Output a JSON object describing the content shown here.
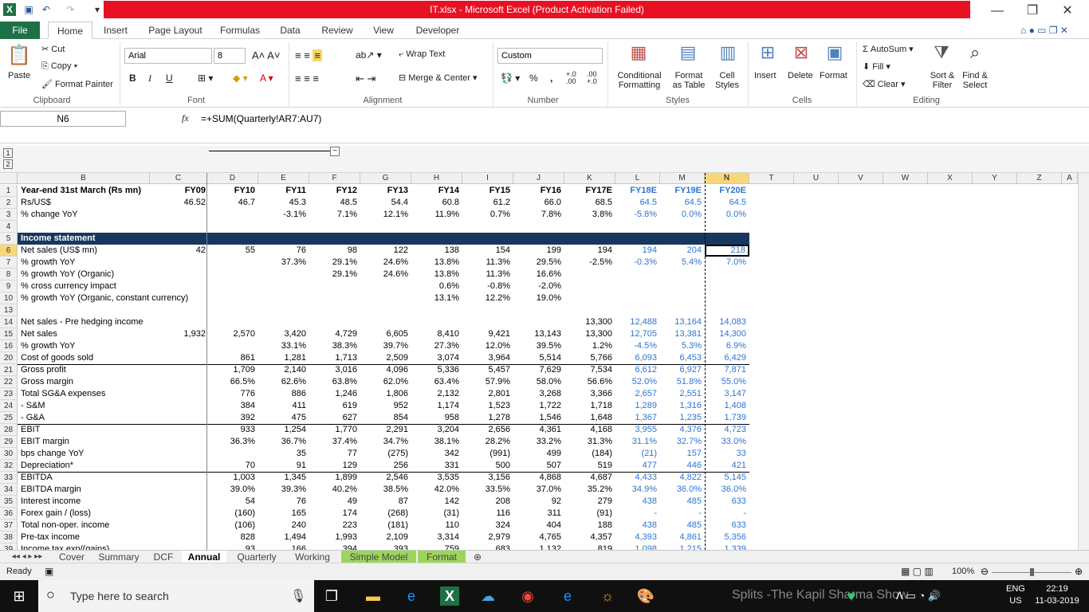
{
  "window": {
    "title": "IT.xlsx  -  Microsoft Excel (Product Activation Failed)"
  },
  "ribbon_tabs": [
    "File",
    "Home",
    "Insert",
    "Page Layout",
    "Formulas",
    "Data",
    "Review",
    "View",
    "Developer"
  ],
  "clipboard": {
    "paste": "Paste",
    "cut": "Cut",
    "copy": "Copy",
    "format_painter": "Format Painter",
    "label": "Clipboard"
  },
  "font": {
    "name": "Arial",
    "size": "8",
    "label": "Font",
    "bold": "B",
    "italic": "I",
    "underline": "U"
  },
  "alignment": {
    "wrap": "Wrap Text",
    "merge": "Merge & Center",
    "label": "Alignment"
  },
  "number": {
    "format": "Custom",
    "percent": "%",
    "comma": ",",
    "inc": "+.0 .00",
    "dec": ".00 +.0",
    "label": "Number"
  },
  "styles": {
    "cond": "Conditional",
    "cond2": "Formatting",
    "fmt_table": "Format",
    "fmt_table2": "as Table",
    "cell_styles": "Cell",
    "cell_styles2": "Styles",
    "label": "Styles"
  },
  "cells": {
    "insert": "Insert",
    "delete": "Delete",
    "format": "Format",
    "label": "Cells"
  },
  "editing": {
    "autosum": "AutoSum",
    "fill": "Fill",
    "clear": "Clear",
    "sort": "Sort &",
    "sort2": "Filter",
    "find": "Find &",
    "find2": "Select",
    "label": "Editing"
  },
  "formula_bar": {
    "name_box": "N6",
    "fx": "fx",
    "formula": "=+SUM(Quarterly!AR7:AU7)"
  },
  "outline_levels": [
    "1",
    "2"
  ],
  "columns": [
    "B",
    "C",
    "D",
    "E",
    "F",
    "G",
    "H",
    "I",
    "J",
    "K",
    "L",
    "M",
    "N",
    "T",
    "U",
    "V",
    "W",
    "X",
    "Y",
    "Z",
    "A"
  ],
  "selected_column": "N",
  "selected_row": "6",
  "rows": [
    {
      "n": "1",
      "label": "Year-end 31st March (Rs mn)",
      "c": "FY09",
      "vals": [
        "FY10",
        "FY11",
        "FY12",
        "FY13",
        "FY14",
        "FY15",
        "FY16",
        "FY17E",
        "FY18E",
        "FY19E",
        "FY20E"
      ],
      "bold": true,
      "header": true
    },
    {
      "n": "2",
      "label": "Rs/US$",
      "c": "46.52",
      "vals": [
        "46.7",
        "45.3",
        "48.5",
        "54.4",
        "60.8",
        "61.2",
        "66.0",
        "68.5",
        "64.5",
        "64.5",
        "64.5"
      ]
    },
    {
      "n": "3",
      "label": "% change YoY",
      "c": "",
      "vals": [
        "",
        "-3.1%",
        "7.1%",
        "12.1%",
        "11.9%",
        "0.7%",
        "7.8%",
        "3.8%",
        "-5.8%",
        "0.0%",
        "0.0%"
      ]
    },
    {
      "n": "4",
      "label": "",
      "c": "",
      "vals": [
        "",
        "",
        "",
        "",
        "",
        "",
        "",
        "",
        "",
        "",
        ""
      ]
    },
    {
      "n": "5",
      "label": "Income statement",
      "c": "",
      "vals": [
        "",
        "",
        "",
        "",
        "",
        "",
        "",
        "",
        "",
        "",
        ""
      ],
      "band": true
    },
    {
      "n": "6",
      "label": "Net sales (US$ mn)",
      "c": "42",
      "vals": [
        "55",
        "76",
        "98",
        "122",
        "138",
        "154",
        "199",
        "194",
        "194",
        "204",
        "218"
      ]
    },
    {
      "n": "7",
      "label": "% growth YoY",
      "c": "",
      "vals": [
        "",
        "37.3%",
        "29.1%",
        "24.6%",
        "13.8%",
        "11.3%",
        "29.5%",
        "-2.5%",
        "-0.3%",
        "5.4%",
        "7.0%"
      ]
    },
    {
      "n": "8",
      "label": "% growth YoY (Organic)",
      "c": "",
      "vals": [
        "",
        "",
        "29.1%",
        "24.6%",
        "13.8%",
        "11.3%",
        "16.6%",
        "",
        "",
        "",
        ""
      ]
    },
    {
      "n": "9",
      "label": "% cross currency impact",
      "c": "",
      "vals": [
        "",
        "",
        "",
        "",
        "0.6%",
        "-0.8%",
        "-2.0%",
        "",
        "",
        "",
        ""
      ]
    },
    {
      "n": "10",
      "label": "% growth YoY (Organic, constant currency)",
      "c": "",
      "vals": [
        "",
        "",
        "",
        "",
        "13.1%",
        "12.2%",
        "19.0%",
        "",
        "",
        "",
        ""
      ]
    },
    {
      "n": "13",
      "label": "",
      "c": "",
      "vals": [
        "",
        "",
        "",
        "",
        "",
        "",
        "",
        "",
        "",
        "",
        ""
      ]
    },
    {
      "n": "14",
      "label": "Net sales - Pre hedging income",
      "c": "",
      "vals": [
        "",
        "",
        "",
        "",
        "",
        "",
        "",
        "13,300",
        "12,488",
        "13,164",
        "14,083"
      ]
    },
    {
      "n": "15",
      "label": "Net sales",
      "c": "1,932",
      "vals": [
        "2,570",
        "3,420",
        "4,729",
        "6,605",
        "8,410",
        "9,421",
        "13,143",
        "13,300",
        "12,705",
        "13,381",
        "14,300"
      ]
    },
    {
      "n": "16",
      "label": "% growth YoY",
      "c": "",
      "vals": [
        "",
        "33.1%",
        "38.3%",
        "39.7%",
        "27.3%",
        "12.0%",
        "39.5%",
        "1.2%",
        "-4.5%",
        "5.3%",
        "6.9%"
      ]
    },
    {
      "n": "20",
      "label": "Cost of goods sold",
      "c": "",
      "vals": [
        "861",
        "1,281",
        "1,713",
        "2,509",
        "3,074",
        "3,964",
        "5,514",
        "5,766",
        "6,093",
        "6,453",
        "6,429"
      ]
    },
    {
      "n": "21",
      "label": "Gross profit",
      "c": "",
      "vals": [
        "1,709",
        "2,140",
        "3,016",
        "4,096",
        "5,336",
        "5,457",
        "7,629",
        "7,534",
        "6,612",
        "6,927",
        "7,871"
      ],
      "topline": true
    },
    {
      "n": "22",
      "label": "Gross margin",
      "c": "",
      "vals": [
        "66.5%",
        "62.6%",
        "63.8%",
        "62.0%",
        "63.4%",
        "57.9%",
        "58.0%",
        "56.6%",
        "52.0%",
        "51.8%",
        "55.0%"
      ]
    },
    {
      "n": "23",
      "label": "Total SG&A expenses",
      "c": "",
      "vals": [
        "776",
        "886",
        "1,246",
        "1,806",
        "2,132",
        "2,801",
        "3,268",
        "3,366",
        "2,657",
        "2,551",
        "3,147"
      ]
    },
    {
      "n": "24",
      "label": " - S&M",
      "c": "",
      "vals": [
        "384",
        "411",
        "619",
        "952",
        "1,174",
        "1,523",
        "1,722",
        "1,718",
        "1,289",
        "1,316",
        "1,408"
      ]
    },
    {
      "n": "25",
      "label": " - G&A",
      "c": "",
      "vals": [
        "392",
        "475",
        "627",
        "854",
        "958",
        "1,278",
        "1,546",
        "1,648",
        "1,367",
        "1,235",
        "1,739"
      ]
    },
    {
      "n": "28",
      "label": "EBIT",
      "c": "",
      "vals": [
        "933",
        "1,254",
        "1,770",
        "2,291",
        "3,204",
        "2,656",
        "4,361",
        "4,168",
        "3,955",
        "4,376",
        "4,723"
      ],
      "topline": true
    },
    {
      "n": "29",
      "label": "EBIT margin",
      "c": "",
      "vals": [
        "36.3%",
        "36.7%",
        "37.4%",
        "34.7%",
        "38.1%",
        "28.2%",
        "33.2%",
        "31.3%",
        "31.1%",
        "32.7%",
        "33.0%"
      ]
    },
    {
      "n": "30",
      "label": "bps change YoY",
      "c": "",
      "vals": [
        "",
        "35",
        "77",
        "(275)",
        "342",
        "(991)",
        "499",
        "(184)",
        "(21)",
        "157",
        "33"
      ]
    },
    {
      "n": "32",
      "label": "Depreciation*",
      "c": "",
      "vals": [
        "70",
        "91",
        "129",
        "256",
        "331",
        "500",
        "507",
        "519",
        "477",
        "446",
        "421"
      ]
    },
    {
      "n": "33",
      "label": "EBITDA",
      "c": "",
      "vals": [
        "1,003",
        "1,345",
        "1,899",
        "2,546",
        "3,535",
        "3,156",
        "4,868",
        "4,687",
        "4,433",
        "4,822",
        "5,145"
      ],
      "topline": true
    },
    {
      "n": "34",
      "label": "EBITDA margin",
      "c": "",
      "vals": [
        "39.0%",
        "39.3%",
        "40.2%",
        "38.5%",
        "42.0%",
        "33.5%",
        "37.0%",
        "35.2%",
        "34.9%",
        "36.0%",
        "36.0%"
      ]
    },
    {
      "n": "35",
      "label": "   Interest income",
      "c": "",
      "vals": [
        "54",
        "76",
        "49",
        "87",
        "142",
        "208",
        "92",
        "279",
        "438",
        "485",
        "633"
      ]
    },
    {
      "n": "36",
      "label": "   Forex gain / (loss)",
      "c": "",
      "vals": [
        "(160)",
        "165",
        "174",
        "(268)",
        "(31)",
        "116",
        "311",
        "(91)",
        "-",
        "-",
        "-"
      ]
    },
    {
      "n": "37",
      "label": "Total non-oper. income",
      "c": "",
      "vals": [
        "(106)",
        "240",
        "223",
        "(181)",
        "110",
        "324",
        "404",
        "188",
        "438",
        "485",
        "633"
      ]
    },
    {
      "n": "38",
      "label": "Pre-tax income",
      "c": "",
      "vals": [
        "828",
        "1,494",
        "1,993",
        "2,109",
        "3,314",
        "2,979",
        "4,765",
        "4,357",
        "4,393",
        "4,861",
        "5,356"
      ]
    },
    {
      "n": "39",
      "label": "Income tax exp/(gains)",
      "c": "",
      "vals": [
        "93",
        "166",
        "394",
        "393",
        "759",
        "683",
        "1,132",
        "819",
        "1,098",
        "1,215",
        "1,339"
      ]
    }
  ],
  "sheet_tabs": [
    "Cover",
    "Summary",
    "DCF",
    "Annual",
    "Quarterly",
    "Working",
    "Simple Model",
    "Format"
  ],
  "active_sheet": "Annual",
  "status": {
    "ready": "Ready",
    "zoom": "100%"
  },
  "taskbar": {
    "search": "Type here to search",
    "lang": "ENG",
    "region": "US",
    "time": "22:19",
    "date": "11-03-2019",
    "ticker": "Splits -The Kapil Sharma Show"
  }
}
